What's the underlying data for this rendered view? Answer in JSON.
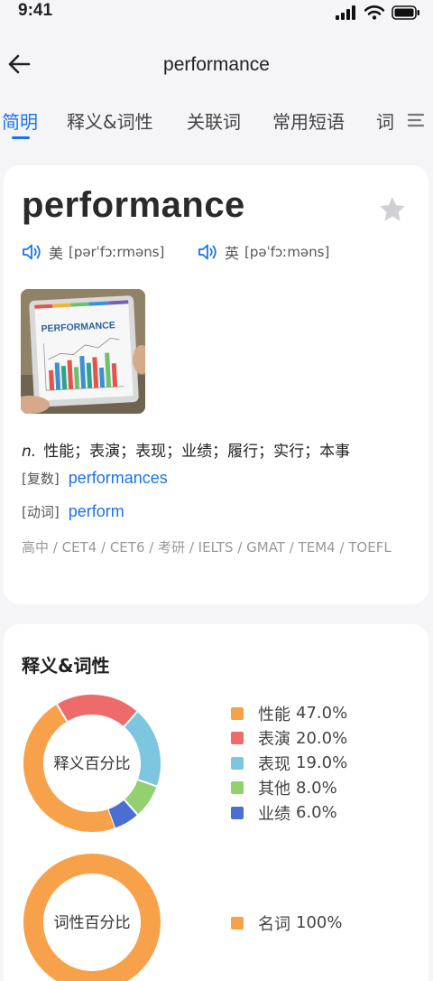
{
  "status": {
    "time": "9:41"
  },
  "nav": {
    "title": "performance"
  },
  "tabs": [
    "简明",
    "释义&词性",
    "关联词",
    "常用短语",
    "词"
  ],
  "word": {
    "headword": "performance",
    "us_label": "美",
    "us_phonetic": "[pərˈfɔːrməns]",
    "uk_label": "英",
    "uk_phonetic": "[pəˈfɔːməns]",
    "image_label": "PERFORMANCE",
    "definition_pos": "n.",
    "definition_text": "性能；表演；表现；业绩；履行；实行；本事",
    "plural_label": "[复数]",
    "plural_value": "performances",
    "verb_label": "[动词]",
    "verb_value": "perform",
    "tags": "高中 / CET4 / CET6 / 考研 / IELTS / GMAT / TEM4 / TOEFL"
  },
  "meanings_section": {
    "title": "释义&词性",
    "meaning_chart_label": "释义百分比",
    "pos_chart_label": "词性百分比"
  },
  "chart_data": [
    {
      "type": "pie",
      "title": "释义百分比",
      "categories": [
        "性能",
        "表演",
        "表现",
        "其他",
        "业绩"
      ],
      "values": [
        47.0,
        20.0,
        19.0,
        8.0,
        6.0
      ],
      "value_labels": [
        "47.0%",
        "20.0%",
        "19.0%",
        "8.0%",
        "6.0%"
      ],
      "colors": [
        "#f7a14a",
        "#ee6b6b",
        "#7cc6e0",
        "#93d06f",
        "#4a6fd0"
      ]
    },
    {
      "type": "pie",
      "title": "词性百分比",
      "categories": [
        "名词"
      ],
      "values": [
        100
      ],
      "value_labels": [
        "100%"
      ],
      "colors": [
        "#f7a14a"
      ]
    }
  ],
  "icons": {
    "back": "back-arrow-icon",
    "star": "star-icon",
    "speaker": "speaker-icon",
    "menu": "menu-icon"
  }
}
